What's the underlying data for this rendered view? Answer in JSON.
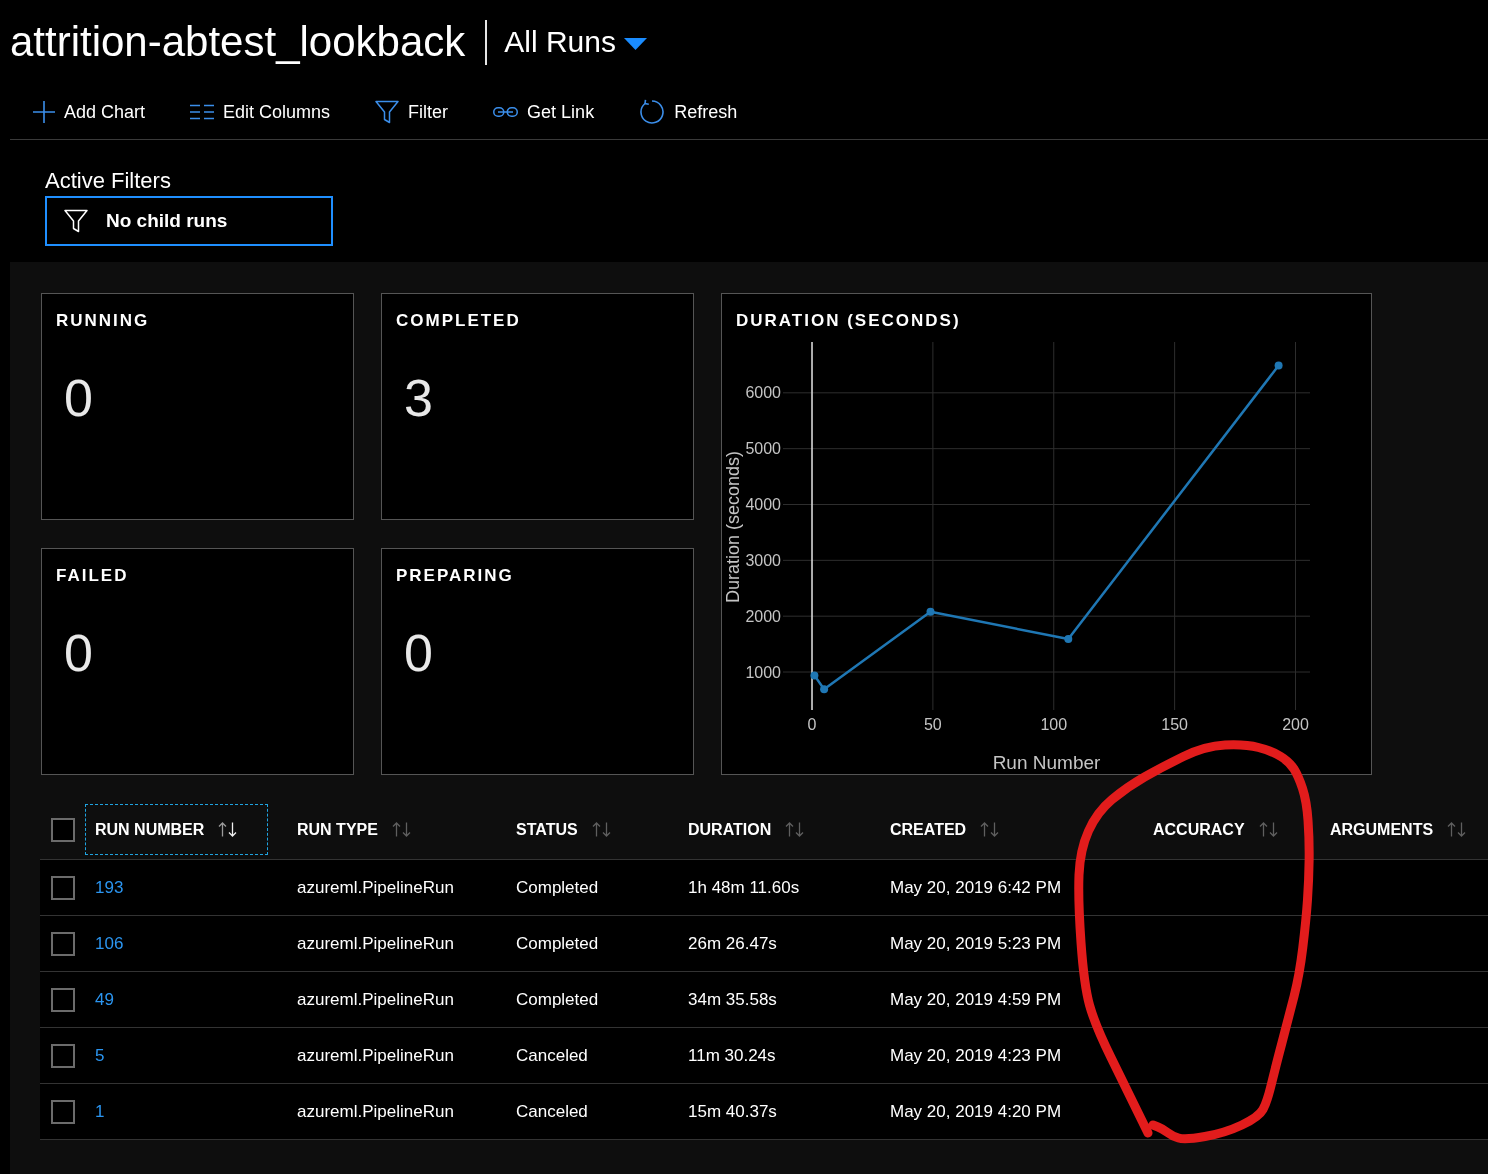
{
  "header": {
    "title": "attrition-abtest_lookback",
    "view": "All Runs"
  },
  "toolbar": [
    {
      "kind": "add",
      "label": "Add Chart"
    },
    {
      "kind": "columns",
      "label": "Edit Columns"
    },
    {
      "kind": "filter",
      "label": "Filter"
    },
    {
      "kind": "link",
      "label": "Get Link"
    },
    {
      "kind": "refresh",
      "label": "Refresh"
    }
  ],
  "active_filters": {
    "label": "Active Filters",
    "filters": [
      "No child runs"
    ]
  },
  "status_cards": [
    {
      "title": "RUNNING",
      "value": "0"
    },
    {
      "title": "COMPLETED",
      "value": "3"
    },
    {
      "title": "FAILED",
      "value": "0"
    },
    {
      "title": "PREPARING",
      "value": "0"
    }
  ],
  "duration_chart": {
    "chart_data": {
      "type": "line",
      "title": "DURATION (SECONDS)",
      "xlabel": "Run Number",
      "ylabel": "Duration (seconds)",
      "x": [
        1,
        5,
        49,
        106,
        193
      ],
      "series": [
        {
          "color": "#1f77b4",
          "marker": true,
          "values": [
            940,
            690,
            2080,
            1590,
            6490
          ]
        }
      ],
      "xlim": [
        -12,
        206
      ],
      "ylim": [
        320,
        6910
      ],
      "xticks": [
        0,
        50,
        100,
        150,
        200
      ],
      "yticks": [
        1000,
        2000,
        3000,
        4000,
        5000,
        6000
      ],
      "grid": true
    }
  },
  "table": {
    "all_selected": false,
    "columns": [
      {
        "label": "RUN NUMBER",
        "focused": true,
        "sorted": true
      },
      {
        "label": "RUN TYPE",
        "focused": false,
        "sorted": false
      },
      {
        "label": "STATUS",
        "focused": false,
        "sorted": false
      },
      {
        "label": "DURATION",
        "focused": false,
        "sorted": false
      },
      {
        "label": "CREATED",
        "focused": false,
        "sorted": false
      },
      {
        "label": "ACCURACY",
        "focused": false,
        "sorted": false
      },
      {
        "label": "ARGUMENTS",
        "focused": false,
        "sorted": false
      }
    ],
    "rows": [
      {
        "checked": false,
        "run_number": "193",
        "run_type": "azureml.PipelineRun",
        "status": "Completed",
        "duration": "1h 48m 11.60s",
        "created": "May 20, 2019 6:42 PM"
      },
      {
        "checked": false,
        "run_number": "106",
        "run_type": "azureml.PipelineRun",
        "status": "Completed",
        "duration": "26m 26.47s",
        "created": "May 20, 2019 5:23 PM"
      },
      {
        "checked": false,
        "run_number": "49",
        "run_type": "azureml.PipelineRun",
        "status": "Completed",
        "duration": "34m 35.58s",
        "created": "May 20, 2019 4:59 PM"
      },
      {
        "checked": false,
        "run_number": "5",
        "run_type": "azureml.PipelineRun",
        "status": "Canceled",
        "duration": "11m 30.24s",
        "created": "May 20, 2019 4:23 PM"
      },
      {
        "checked": false,
        "run_number": "1",
        "run_type": "azureml.PipelineRun",
        "status": "Canceled",
        "duration": "15m 40.37s",
        "created": "May 20, 2019 4:20 PM"
      }
    ]
  },
  "annotation": {
    "kind": "loop"
  }
}
